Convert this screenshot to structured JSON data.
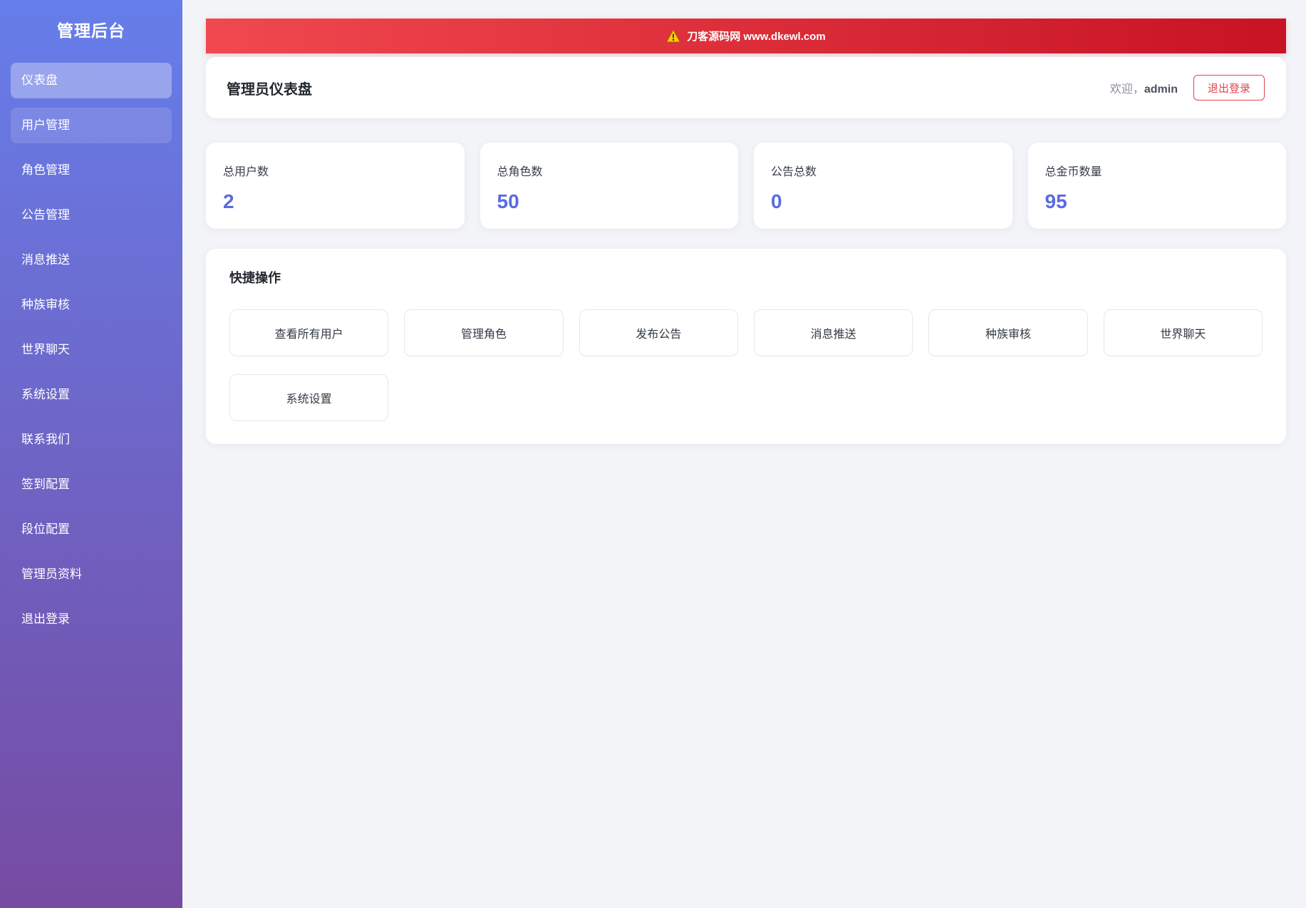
{
  "sidebar": {
    "title": "管理后台",
    "items": [
      {
        "id": "dashboard",
        "label": "仪表盘",
        "active": true
      },
      {
        "id": "users",
        "label": "用户管理",
        "hovered": true
      },
      {
        "id": "roles",
        "label": "角色管理"
      },
      {
        "id": "announcements",
        "label": "公告管理"
      },
      {
        "id": "message-push",
        "label": "消息推送"
      },
      {
        "id": "race-review",
        "label": "种族审核"
      },
      {
        "id": "world-chat",
        "label": "世界聊天"
      },
      {
        "id": "system",
        "label": "系统设置"
      },
      {
        "id": "contact",
        "label": "联系我们"
      },
      {
        "id": "checkin",
        "label": "签到配置"
      },
      {
        "id": "rank",
        "label": "段位配置"
      },
      {
        "id": "admin-profile",
        "label": "管理员资料"
      },
      {
        "id": "logout",
        "label": "退出登录"
      }
    ]
  },
  "banner": {
    "icon": "warning-icon",
    "text": "刀客源码网 www.dkewl.com"
  },
  "header": {
    "title": "管理员仪表盘",
    "welcome_prefix": "欢迎，",
    "username": "admin",
    "logout_label": "退出登录"
  },
  "stats": [
    {
      "id": "users-total",
      "label": "总用户数",
      "value": 2
    },
    {
      "id": "roles-total",
      "label": "总角色数",
      "value": 50
    },
    {
      "id": "announcements-total",
      "label": "公告总数",
      "value": 0
    },
    {
      "id": "coins-total",
      "label": "总金币数量",
      "value": 95
    }
  ],
  "quick_actions": {
    "title": "快捷操作",
    "buttons": [
      {
        "id": "view-users",
        "label": "查看所有用户"
      },
      {
        "id": "manage-roles",
        "label": "管理角色"
      },
      {
        "id": "publish-announcement",
        "label": "发布公告"
      },
      {
        "id": "message-push",
        "label": "消息推送"
      },
      {
        "id": "race-review",
        "label": "种族审核"
      },
      {
        "id": "world-chat",
        "label": "世界聊天"
      },
      {
        "id": "system-settings",
        "label": "系统设置"
      }
    ]
  },
  "colors": {
    "sidebar_top": "#667eea",
    "sidebar_bottom": "#764ba2",
    "banner_left": "#f1484f",
    "banner_right": "#c71324",
    "stat_value": "#5a6ae0",
    "logout_red": "#e2444e",
    "content_bg": "#f3f4f8"
  }
}
